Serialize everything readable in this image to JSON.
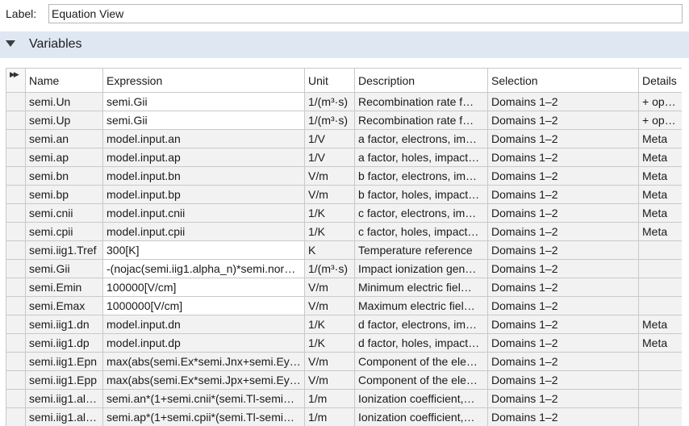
{
  "label": {
    "caption": "Label:",
    "value": "Equation View"
  },
  "section": {
    "title": "Variables"
  },
  "table": {
    "columns": [
      "Name",
      "Expression",
      "Unit",
      "Description",
      "Selection",
      "Details"
    ],
    "rows": [
      {
        "name": "semi.Un",
        "expression": "semi.Gii",
        "unit": "1/(m³·s)",
        "description": "Recombination rate f…",
        "selection": "Domains 1–2",
        "details": "+ oper…"
      },
      {
        "name": "semi.Up",
        "expression": "semi.Gii",
        "unit": "1/(m³·s)",
        "description": "Recombination rate f…",
        "selection": "Domains 1–2",
        "details": "+ oper…"
      },
      {
        "name": "semi.an",
        "expression": "model.input.an",
        "unit": "1/V",
        "description": "a factor, electrons, im…",
        "selection": "Domains 1–2",
        "details": "Meta"
      },
      {
        "name": "semi.ap",
        "expression": "model.input.ap",
        "unit": "1/V",
        "description": "a factor, holes, impact…",
        "selection": "Domains 1–2",
        "details": "Meta"
      },
      {
        "name": "semi.bn",
        "expression": "model.input.bn",
        "unit": "V/m",
        "description": "b factor, electrons, im…",
        "selection": "Domains 1–2",
        "details": "Meta"
      },
      {
        "name": "semi.bp",
        "expression": "model.input.bp",
        "unit": "V/m",
        "description": "b factor, holes, impact…",
        "selection": "Domains 1–2",
        "details": "Meta"
      },
      {
        "name": "semi.cnii",
        "expression": "model.input.cnii",
        "unit": "1/K",
        "description": "c factor, electrons, im…",
        "selection": "Domains 1–2",
        "details": "Meta"
      },
      {
        "name": "semi.cpii",
        "expression": "model.input.cpii",
        "unit": "1/K",
        "description": "c factor, holes, impact…",
        "selection": "Domains 1–2",
        "details": "Meta"
      },
      {
        "name": "semi.iig1.Tref",
        "expression": "300[K]",
        "unit": "K",
        "description": "Temperature reference",
        "selection": "Domains 1–2",
        "details": ""
      },
      {
        "name": "semi.Gii",
        "expression": "-(nojac(semi.iig1.alpha_n)*semi.nor…",
        "unit": "1/(m³·s)",
        "description": "Impact ionization gen…",
        "selection": "Domains 1–2",
        "details": ""
      },
      {
        "name": "semi.Emin",
        "expression": "100000[V/cm]",
        "unit": "V/m",
        "description": "Minimum electric fiel…",
        "selection": "Domains 1–2",
        "details": ""
      },
      {
        "name": "semi.Emax",
        "expression": "1000000[V/cm]",
        "unit": "V/m",
        "description": "Maximum electric fiel…",
        "selection": "Domains 1–2",
        "details": ""
      },
      {
        "name": "semi.iig1.dn",
        "expression": "model.input.dn",
        "unit": "1/K",
        "description": "d factor, electrons, im…",
        "selection": "Domains 1–2",
        "details": "Meta"
      },
      {
        "name": "semi.iig1.dp",
        "expression": "model.input.dp",
        "unit": "1/K",
        "description": "d factor, holes, impact…",
        "selection": "Domains 1–2",
        "details": "Meta"
      },
      {
        "name": "semi.iig1.Epn",
        "expression": "max(abs(semi.Ex*semi.Jnx+semi.Ey*…",
        "unit": "V/m",
        "description": "Component of the ele…",
        "selection": "Domains 1–2",
        "details": ""
      },
      {
        "name": "semi.iig1.Epp",
        "expression": "max(abs(semi.Ex*semi.Jpx+semi.Ey…",
        "unit": "V/m",
        "description": "Component of the ele…",
        "selection": "Domains 1–2",
        "details": ""
      },
      {
        "name": "semi.iig1.al…",
        "expression": "semi.an*(1+semi.cnii*(semi.Tl-semi…",
        "unit": "1/m",
        "description": "Ionization coefficient,…",
        "selection": "Domains 1–2",
        "details": ""
      },
      {
        "name": "semi.iig1.al…",
        "expression": "semi.ap*(1+semi.cpii*(semi.Tl-semi…",
        "unit": "1/m",
        "description": "Ionization coefficient,…",
        "selection": "Domains 1–2",
        "details": ""
      }
    ]
  }
}
